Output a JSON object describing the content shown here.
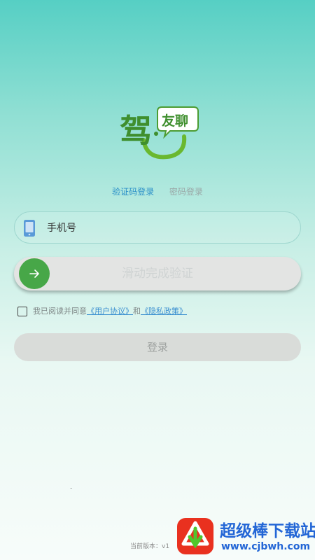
{
  "colors": {
    "accent_blue": "#2a8fc8",
    "brand_green": "#47a748",
    "background_top": "#56cfc4",
    "link_blue": "#3a8fd0"
  },
  "logo": {
    "text_main": "驾",
    "text_bubble": "友聊",
    "icon": "jiayouliao-logo"
  },
  "tabs": [
    {
      "label": "验证码登录",
      "active": true
    },
    {
      "label": "密码登录",
      "active": false
    }
  ],
  "phone_field": {
    "placeholder": "手机号",
    "value": "",
    "icon": "phone-icon"
  },
  "slider": {
    "label": "滑动完成验证",
    "handle_icon": "arrow-right-icon"
  },
  "agreement": {
    "checked": false,
    "prefix": "我已阅读并同意",
    "user_agreement": "《用户协议》",
    "conjunction": "和",
    "privacy_policy": "《隐私政策》"
  },
  "login_button": {
    "label": "登录"
  },
  "version": {
    "text": "当前版本：v1"
  },
  "watermark": {
    "title": "超级棒下载站",
    "url": "www.cjbwh.com"
  }
}
